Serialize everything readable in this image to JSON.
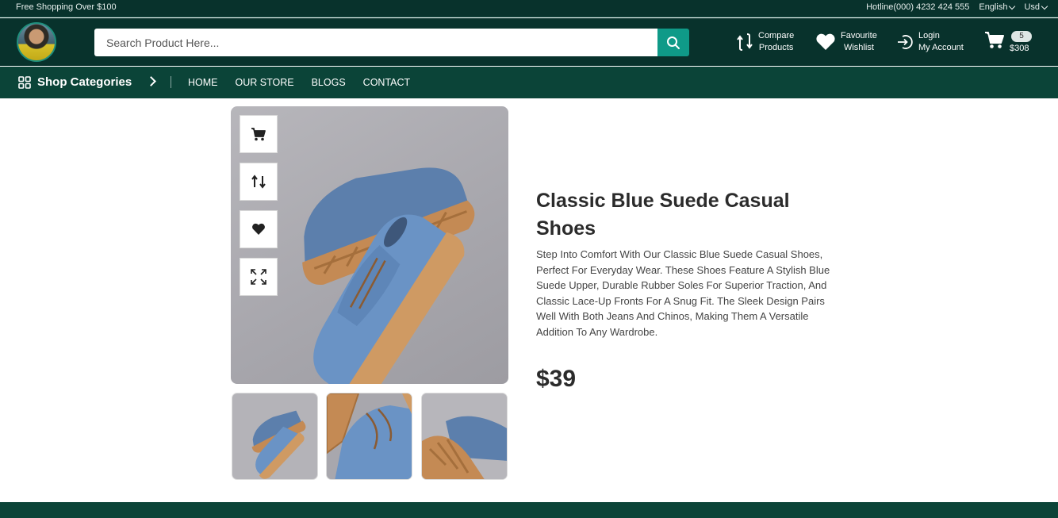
{
  "topbar": {
    "promo": "Free Shopping Over $100",
    "hotline": "Hotline(000) 4232 424 555",
    "language": "English",
    "currency": "Usd"
  },
  "header": {
    "search_placeholder": "Search Product Here...",
    "compare_line1": "Compare",
    "compare_line2": "Products",
    "wishlist_line1": "Favourite",
    "wishlist_line2": "Wishlist",
    "login_line1": "Login",
    "login_line2": "My Account",
    "cart_count": "5",
    "cart_total": "$308"
  },
  "nav": {
    "categories_label": "Shop Categories",
    "items": [
      "HOME",
      "OUR STORE",
      "BLOGS",
      "CONTACT"
    ]
  },
  "product": {
    "title": "Classic Blue Suede Casual Shoes",
    "description": "Step Into Comfort With Our Classic Blue Suede Casual Shoes, Perfect For Everyday Wear. These Shoes Feature A Stylish Blue Suede Upper, Durable Rubber Soles For Superior Traction, And Classic Lace-Up Fronts For A Snug Fit. The Sleek Design Pairs Well With Both Jeans And Chinos, Making Them A Versatile Addition To Any Wardrobe.",
    "price": "$39",
    "actions": [
      "cart-icon",
      "compare-icon",
      "heart-icon",
      "expand-icon"
    ]
  },
  "colors": {
    "dark_green": "#08322c",
    "nav_green": "#0b4438",
    "accent_teal": "#0f9a88"
  }
}
